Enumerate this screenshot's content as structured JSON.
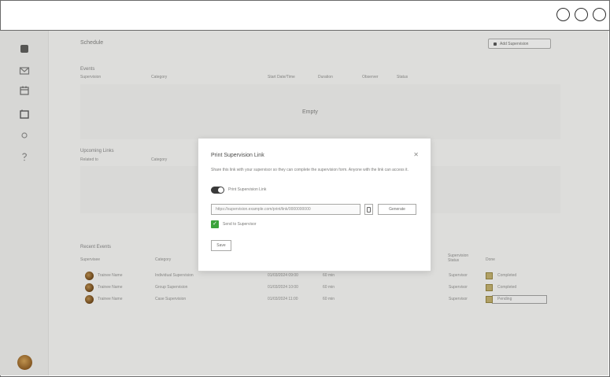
{
  "window": {
    "controls": [
      "minimize",
      "maximize",
      "close"
    ]
  },
  "page": {
    "title": "Schedule",
    "top_button": "Add Supervision"
  },
  "sections": {
    "events": {
      "label": "Events",
      "columns": [
        "Supervision",
        "Category",
        "Start Date/Time",
        "Duration",
        "Observer",
        "Status"
      ],
      "empty": "Empty"
    },
    "upcoming": {
      "label": "Upcoming Links",
      "columns": [
        "Related to",
        "Category"
      ]
    },
    "recent": {
      "label": "Recent Events",
      "columns": [
        "Supervisee",
        "Category",
        "Supervision Status",
        "Done"
      ],
      "rows": [
        {
          "name": "Trainee Name",
          "category": "Individual Supervision",
          "date": "01/03/2024 09:00",
          "duration": "60 min",
          "observer": "Supervisor",
          "status": "Completed"
        },
        {
          "name": "Trainee Name",
          "category": "Group Supervision",
          "date": "01/03/2024 10:00",
          "duration": "60 min",
          "observer": "Supervisor",
          "status": "Completed"
        },
        {
          "name": "Trainee Name",
          "category": "Case Supervision",
          "date": "01/03/2024 11:00",
          "duration": "60 min",
          "observer": "Supervisor",
          "status": "Pending"
        }
      ]
    }
  },
  "modal": {
    "title": "Print Supervision Link",
    "description": "Share this link with your supervisor so they can complete the supervision form. Anyone with the link can access it.",
    "toggle_label": "Print Supervision Link",
    "link_value": "https://supervision.example.com/print/link/0000000000",
    "generate_label": "Generate",
    "check_label": "Send to Supervisor",
    "save_label": "Save"
  }
}
